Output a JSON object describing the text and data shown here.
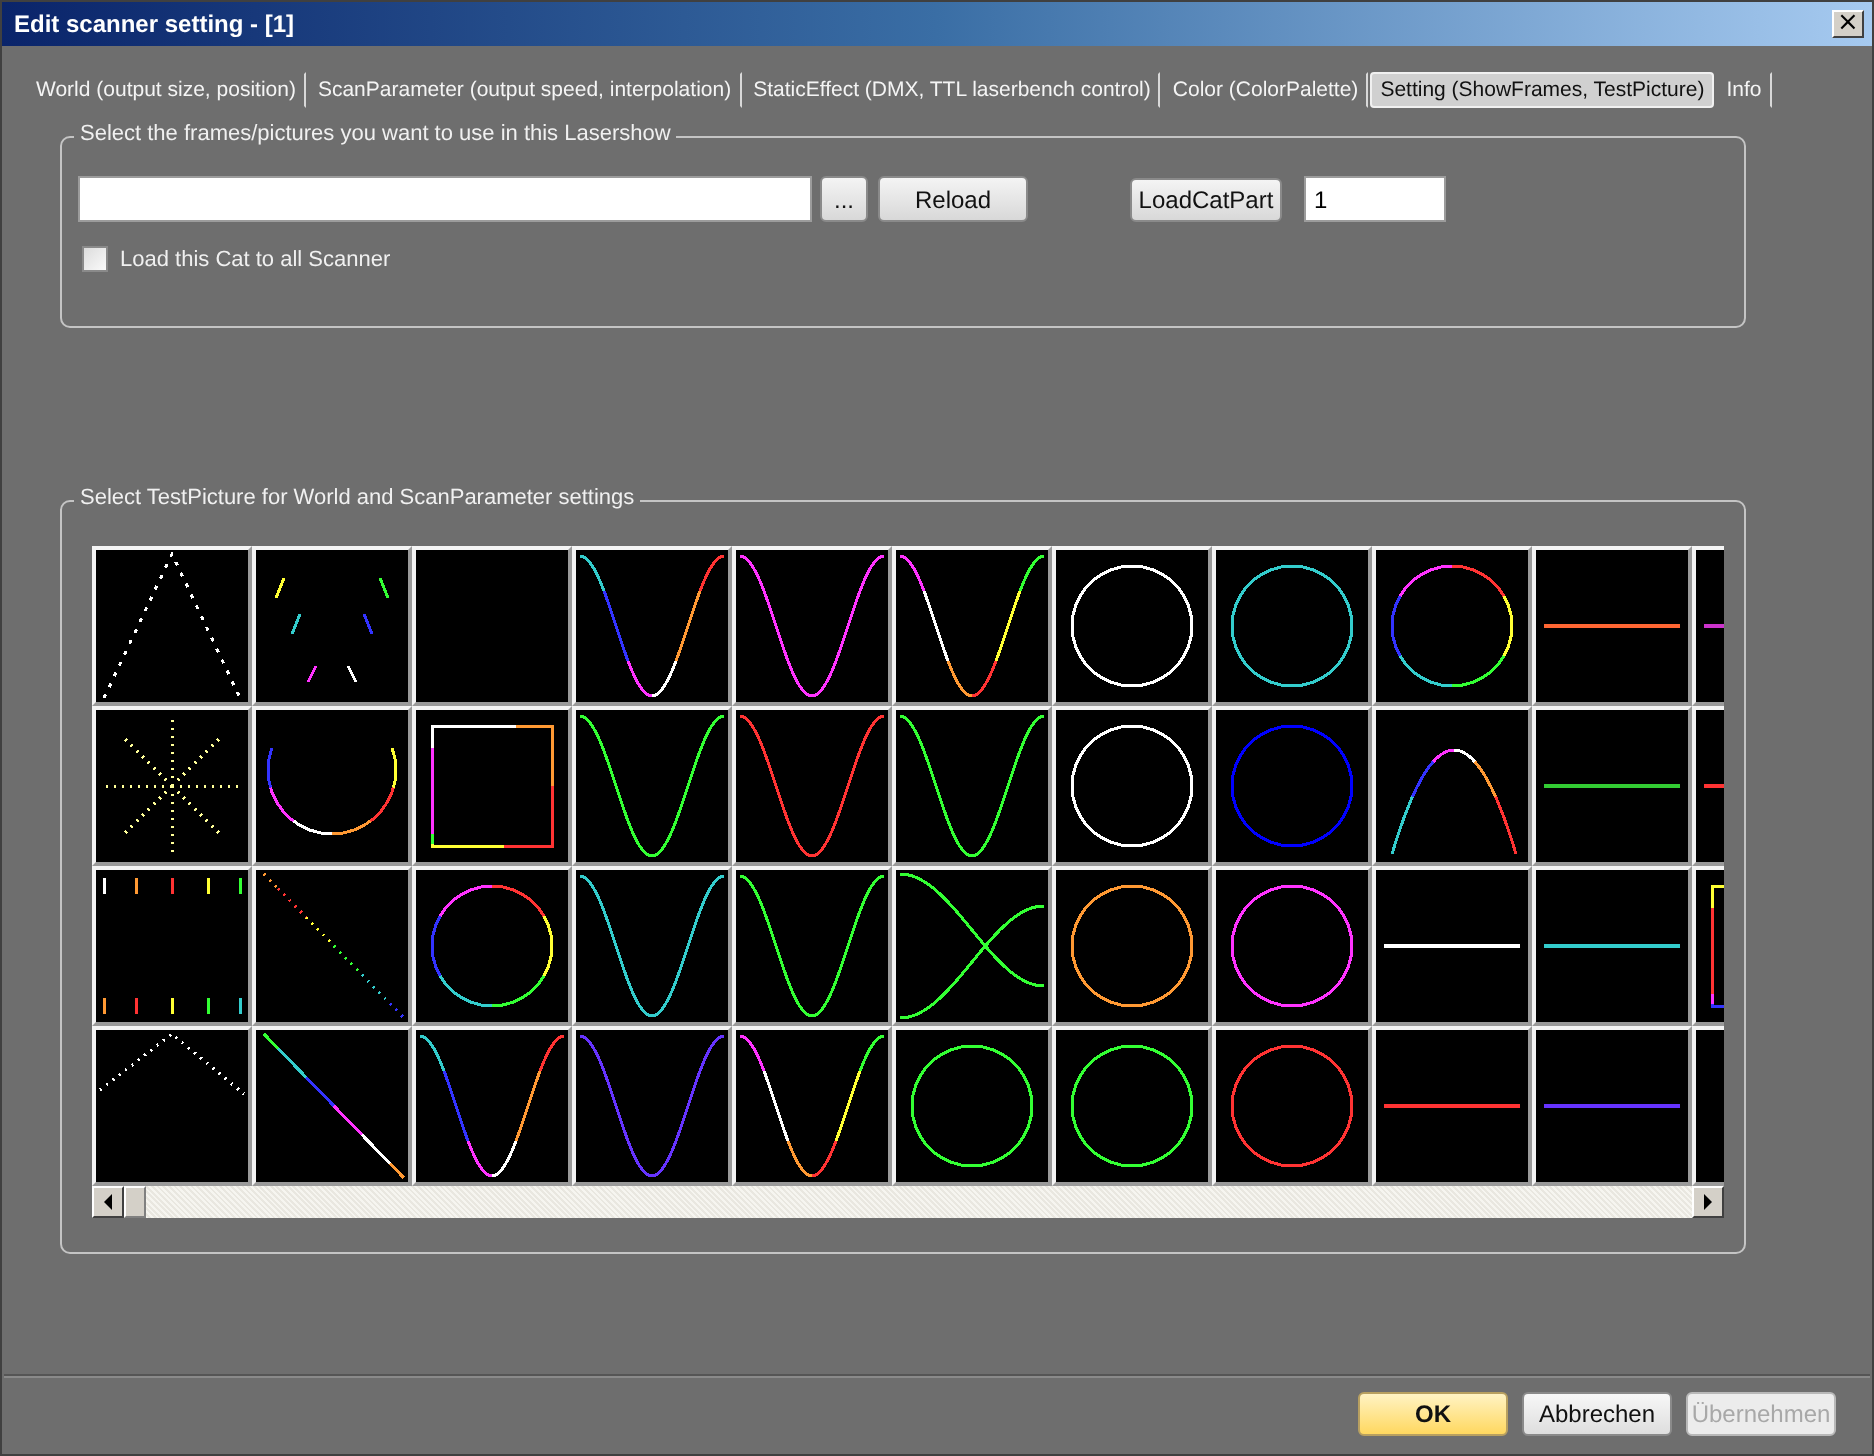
{
  "window": {
    "title": "Edit scanner setting - [1]",
    "close": "×"
  },
  "tabs": [
    {
      "label": "World (output size, position)",
      "selected": false
    },
    {
      "label": "ScanParameter (output speed, interpolation)",
      "selected": false
    },
    {
      "label": "StaticEffect (DMX, TTL laserbench control)",
      "selected": false
    },
    {
      "label": "Color (ColorPalette)",
      "selected": false
    },
    {
      "label": "Setting (ShowFrames, TestPicture)",
      "selected": true
    },
    {
      "label": "Info",
      "selected": false
    }
  ],
  "frames_group": {
    "title": "Select the frames/pictures you want to use in this Lasershow",
    "browse_button": "...",
    "reload_button": "Reload",
    "load_cat_part_button": "LoadCatPart",
    "part_value": "1",
    "load_all_checkbox": {
      "label": "Load this Cat to all Scanner",
      "checked": false
    }
  },
  "test_picture_group": {
    "title": "Select TestPicture for World and ScanParameter settings",
    "pictures": [
      {
        "kind": "dotted-arch",
        "multicolor": false,
        "color": "#ffffff"
      },
      {
        "kind": "arc-dashes",
        "multicolor": true
      },
      {
        "kind": "blank"
      },
      {
        "kind": "sine",
        "multicolor": true
      },
      {
        "kind": "sine",
        "multicolor": false,
        "color": "#ff33ff"
      },
      {
        "kind": "sine",
        "multicolor": true
      },
      {
        "kind": "circle",
        "multicolor": false,
        "color": "#ffffff"
      },
      {
        "kind": "circle",
        "multicolor": false,
        "color": "#33cccc"
      },
      {
        "kind": "circle",
        "multicolor": true
      },
      {
        "kind": "line",
        "multicolor": false,
        "color": "#ff6633"
      },
      {
        "kind": "line",
        "multicolor": false,
        "color": "#cc33cc"
      },
      {
        "kind": "dotted-star",
        "multicolor": false,
        "color": "#ffff99"
      },
      {
        "kind": "bowl",
        "multicolor": true
      },
      {
        "kind": "square",
        "multicolor": true
      },
      {
        "kind": "sine",
        "multicolor": false,
        "color": "#33ff33"
      },
      {
        "kind": "sine",
        "multicolor": false,
        "color": "#ff3333"
      },
      {
        "kind": "sine",
        "multicolor": false,
        "color": "#33ff33"
      },
      {
        "kind": "circle",
        "multicolor": false,
        "color": "#ffffff"
      },
      {
        "kind": "circle",
        "multicolor": false,
        "color": "#0000ff"
      },
      {
        "kind": "arch",
        "multicolor": true
      },
      {
        "kind": "line",
        "multicolor": false,
        "color": "#33cc33"
      },
      {
        "kind": "line",
        "multicolor": false,
        "color": "#ff3333"
      },
      {
        "kind": "ticks",
        "multicolor": true
      },
      {
        "kind": "dotted-diagonal",
        "multicolor": true
      },
      {
        "kind": "circle",
        "multicolor": true
      },
      {
        "kind": "sine",
        "multicolor": false,
        "color": "#33cccc"
      },
      {
        "kind": "sine",
        "multicolor": false,
        "color": "#33ff33"
      },
      {
        "kind": "crossing-curves",
        "multicolor": false,
        "color": "#33ff33"
      },
      {
        "kind": "circle",
        "multicolor": false,
        "color": "#ff9933"
      },
      {
        "kind": "circle",
        "multicolor": false,
        "color": "#ff33ff"
      },
      {
        "kind": "line",
        "multicolor": false,
        "color": "#ffffff"
      },
      {
        "kind": "line",
        "multicolor": false,
        "color": "#33cccc"
      },
      {
        "kind": "square",
        "multicolor": true
      },
      {
        "kind": "dotted-chevron",
        "multicolor": false,
        "color": "#ffffff"
      },
      {
        "kind": "diagonal",
        "multicolor": true
      },
      {
        "kind": "sine",
        "multicolor": true
      },
      {
        "kind": "sine",
        "multicolor": false,
        "color": "#6633ff"
      },
      {
        "kind": "sine",
        "multicolor": true
      },
      {
        "kind": "circle",
        "multicolor": false,
        "color": "#33ff33"
      },
      {
        "kind": "circle",
        "multicolor": false,
        "color": "#33ff33"
      },
      {
        "kind": "circle",
        "multicolor": false,
        "color": "#ff3333"
      },
      {
        "kind": "line",
        "multicolor": false,
        "color": "#ff3333"
      },
      {
        "kind": "line",
        "multicolor": false,
        "color": "#6633ff"
      },
      {
        "kind": "blank"
      }
    ]
  },
  "buttons": [
    {
      "label": "OK",
      "kind": "default",
      "disabled": false
    },
    {
      "label": "Abbrechen",
      "kind": "normal",
      "disabled": false
    },
    {
      "label": "Übernehmen",
      "kind": "normal",
      "disabled": true
    }
  ]
}
